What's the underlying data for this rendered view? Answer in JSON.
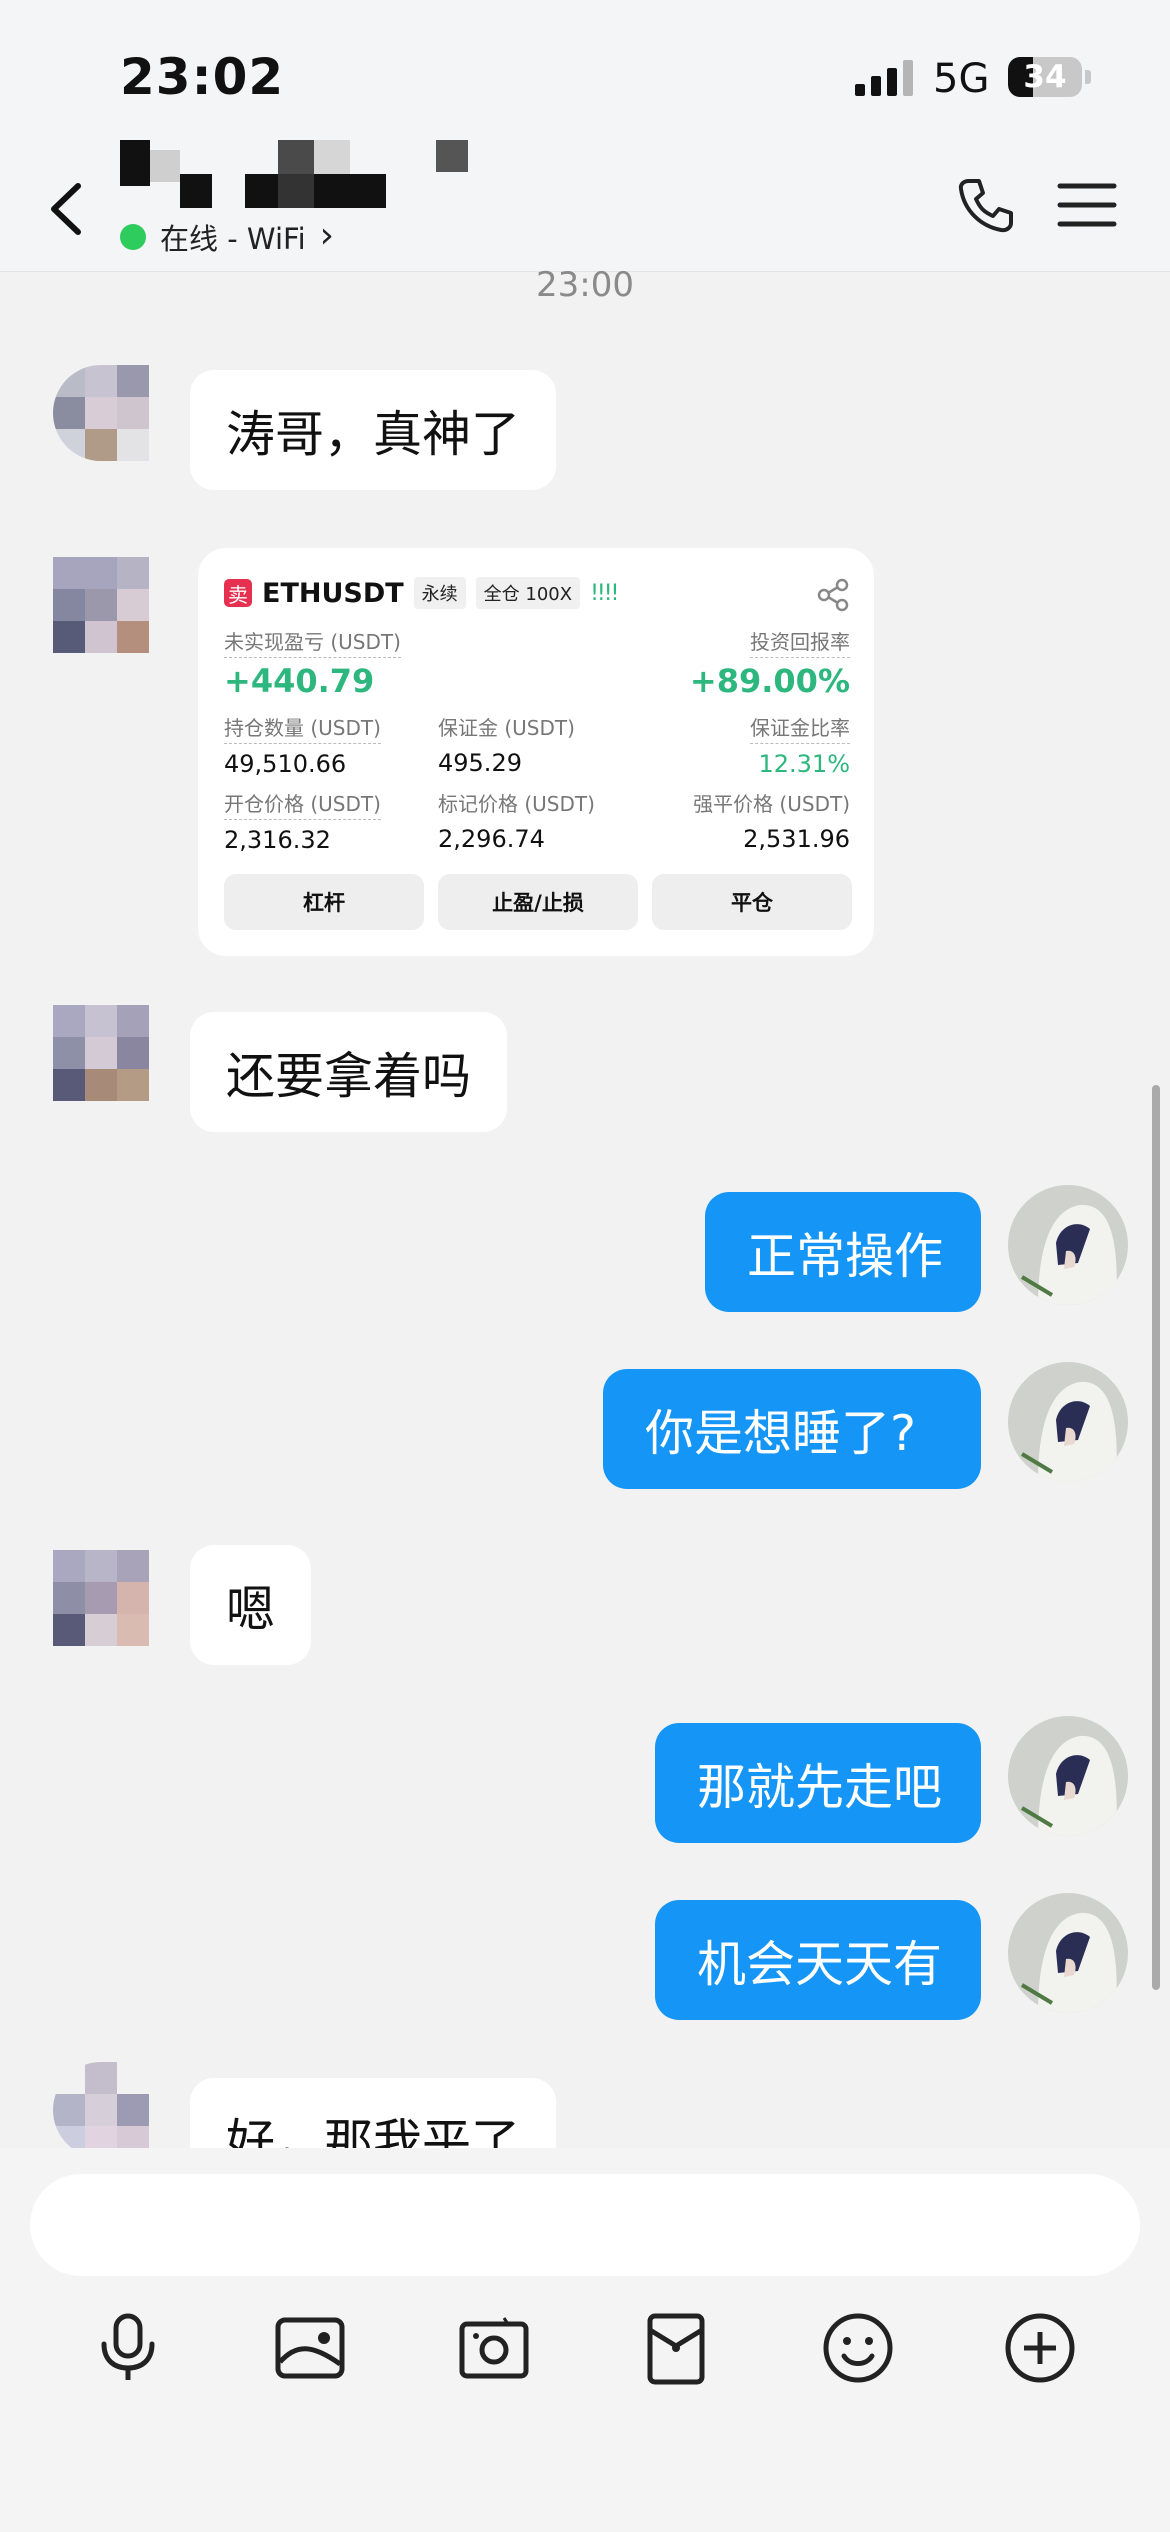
{
  "status_bar": {
    "time": "23:02",
    "network": "5G",
    "battery": "34",
    "battery_level": 0.34
  },
  "header": {
    "status_text": "在线 - WiFi",
    "chevron": "›"
  },
  "timestamp": "23:00",
  "messages": [
    {
      "side": "in",
      "text": "涛哥，真神了"
    },
    {
      "side": "in",
      "type": "trade-card"
    },
    {
      "side": "in",
      "text": "还要拿着吗"
    },
    {
      "side": "out",
      "text": "正常操作"
    },
    {
      "side": "out",
      "text": "你是想睡了?"
    },
    {
      "side": "in",
      "text": "嗯"
    },
    {
      "side": "out",
      "text": "那就先走吧"
    },
    {
      "side": "out",
      "text": "机会天天有"
    },
    {
      "side": "in",
      "text": "好，那我平了"
    }
  ],
  "trade_card": {
    "badge": "卖",
    "symbol": "ETHUSDT",
    "tag1": "永续",
    "tag2": "全仓 100X",
    "bars": "!!!!",
    "unrealized_label": "未实现盈亏 (USDT)",
    "unrealized_value": "+440.79",
    "roi_label": "投资回报率",
    "roi_value": "+89.00%",
    "position_label": "持仓数量 (USDT)",
    "position_value": "49,510.66",
    "margin_label": "保证金 (USDT)",
    "margin_value": "495.29",
    "margin_ratio_label": "保证金比率",
    "margin_ratio_value": "12.31%",
    "entry_label": "开仓价格 (USDT)",
    "entry_value": "2,316.32",
    "mark_label": "标记价格 (USDT)",
    "mark_value": "2,296.74",
    "liq_label": "强平价格 (USDT)",
    "liq_value": "2,531.96",
    "btn_leverage": "杠杆",
    "btn_tpsl": "止盈/止损",
    "btn_close": "平仓"
  },
  "toolbar_icons": [
    "microphone-icon",
    "image-icon",
    "camera-icon",
    "red-packet-icon",
    "emoji-icon",
    "plus-icon"
  ],
  "colors": {
    "accent_blue": "#1596f6",
    "online_green": "#2ecc5c",
    "profit_green": "#2db67d",
    "sell_red": "#e6304f"
  }
}
